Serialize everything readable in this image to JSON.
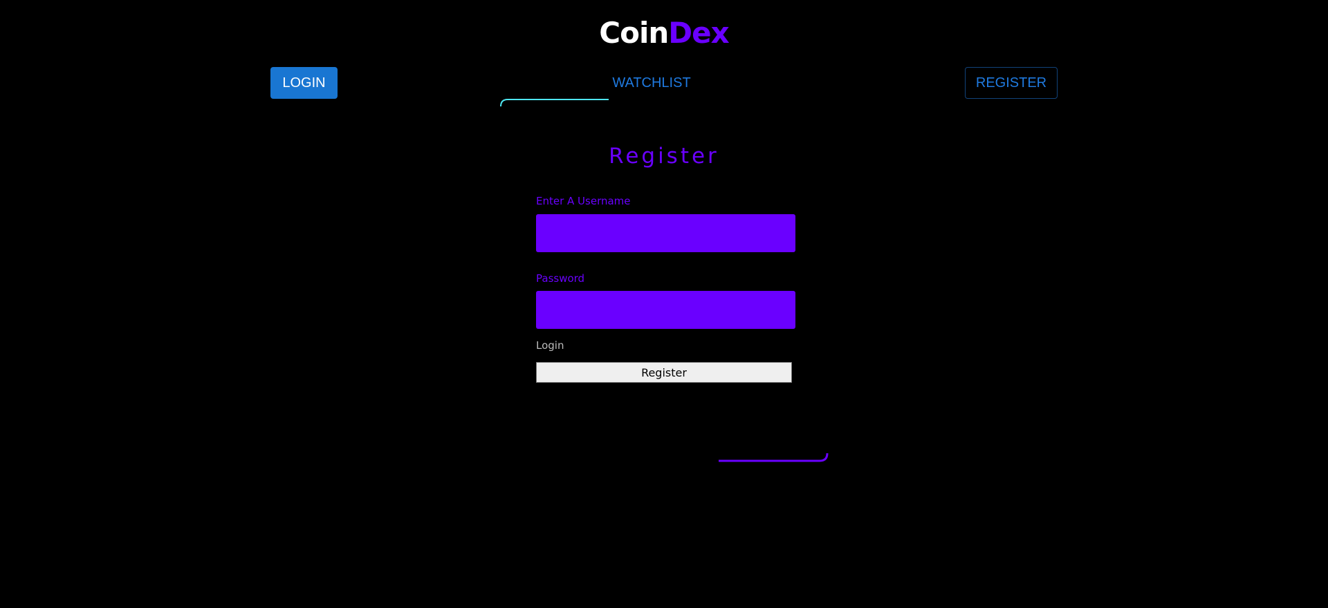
{
  "brand": {
    "part1": "Coin",
    "part2": "Dex",
    "colors": {
      "primary_text": "#ffffff",
      "accent": "#6a00ff"
    }
  },
  "nav": {
    "login_label": "LOGIN",
    "watchlist_label": "WATCHLIST",
    "register_label": "REGISTER",
    "colors": {
      "login_bg": "#1976d2",
      "link": "#1f7ae0"
    }
  },
  "form": {
    "title": "Register",
    "username_label": "Enter A Username",
    "username_value": "",
    "password_label": "Password",
    "password_value": "",
    "login_link": "Login",
    "submit_label": "Register",
    "colors": {
      "frame_start": "#4ee6f0",
      "frame_end": "#6a00ff",
      "input_bg": "#6a00ff"
    }
  }
}
